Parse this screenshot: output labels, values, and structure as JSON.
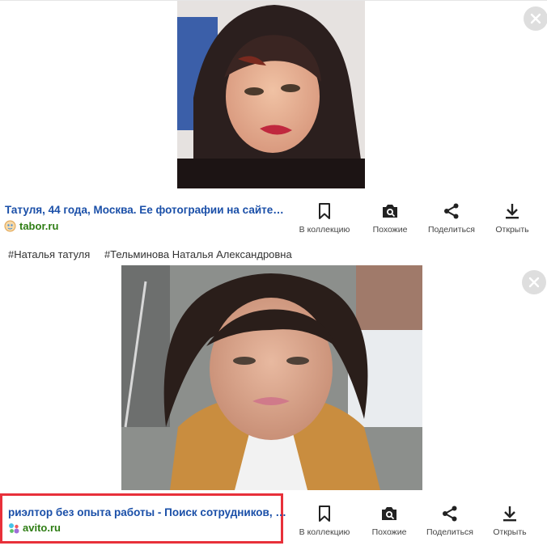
{
  "results": [
    {
      "title": "Татуля, 44 года, Москва. Ее фотографии на сайте…",
      "source": "tabor.ru",
      "image_alt": "woman portrait photo"
    },
    {
      "title": "риэлтор без опыта работы - Поиск сотрудников, …",
      "source": "avito.ru",
      "image_alt": "woman selfie outdoors photo"
    }
  ],
  "actions": {
    "collection": "В коллекцию",
    "similar": "Похожие",
    "share": "Поделиться",
    "open": "Открыть"
  },
  "tags": [
    "#Наталья татуля",
    "#Тельминова Наталья Александровна"
  ],
  "colors": {
    "title_link": "#1a4fa8",
    "source_link": "#2e7d14",
    "highlight_border": "#e8303a"
  }
}
